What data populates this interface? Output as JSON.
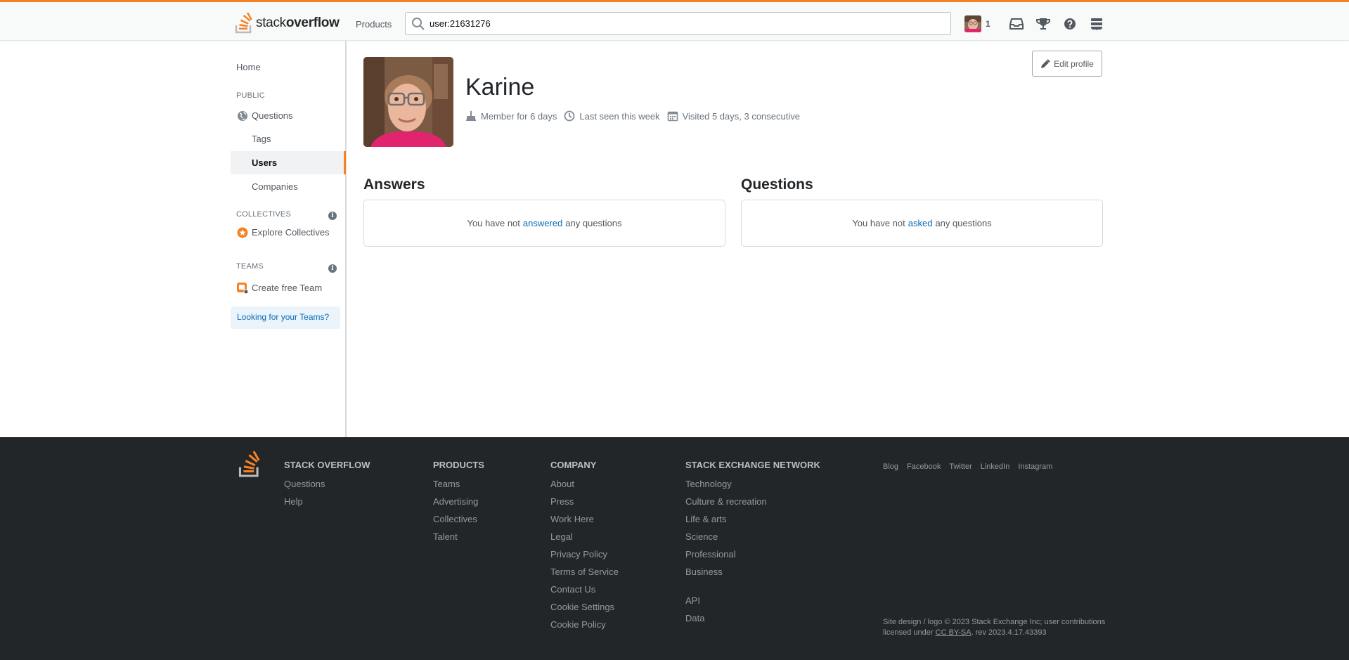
{
  "topbar": {
    "logo_light": "stack",
    "logo_bold": "overflow",
    "products_label": "Products",
    "search_value": "user:21631276",
    "reputation": "1",
    "accent_color": "#f48225"
  },
  "sidebar": {
    "home": "Home",
    "public_heading": "PUBLIC",
    "questions": "Questions",
    "tags": "Tags",
    "users": "Users",
    "companies": "Companies",
    "collectives_heading": "COLLECTIVES",
    "explore_collectives": "Explore Collectives",
    "teams_heading": "TEAMS",
    "create_team": "Create free Team",
    "looking_for_teams": "Looking for your Teams?"
  },
  "profile": {
    "name": "Karine",
    "member_for": "Member for 6 days",
    "last_seen": "Last seen this week",
    "visited": "Visited 5 days, 3 consecutive",
    "edit_label": "Edit profile"
  },
  "sections": {
    "answers_title": "Answers",
    "answers_pre": "You have not",
    "answers_link": "answered",
    "answers_post": "any questions",
    "questions_title": "Questions",
    "questions_pre": "You have not",
    "questions_link": "asked",
    "questions_post": "any questions"
  },
  "footer": {
    "stackoverflow": {
      "heading": "STACK OVERFLOW",
      "links": [
        "Questions",
        "Help"
      ]
    },
    "products": {
      "heading": "PRODUCTS",
      "links": [
        "Teams",
        "Advertising",
        "Collectives",
        "Talent"
      ]
    },
    "company": {
      "heading": "COMPANY",
      "links": [
        "About",
        "Press",
        "Work Here",
        "Legal",
        "Privacy Policy",
        "Terms of Service",
        "Contact Us",
        "Cookie Settings",
        "Cookie Policy"
      ]
    },
    "network": {
      "heading": "STACK EXCHANGE NETWORK",
      "links": [
        "Technology",
        "Culture & recreation",
        "Life & arts",
        "Science",
        "Professional",
        "Business"
      ],
      "extra_links": [
        "API",
        "Data"
      ]
    },
    "social": [
      "Blog",
      "Facebook",
      "Twitter",
      "LinkedIn",
      "Instagram"
    ],
    "copyright_line1": "Site design / logo © 2023 Stack Exchange Inc; user contributions",
    "copyright_pre": "licensed under",
    "copyright_license": "CC BY-SA",
    "copyright_post": ". rev 2023.4.17.43393"
  }
}
